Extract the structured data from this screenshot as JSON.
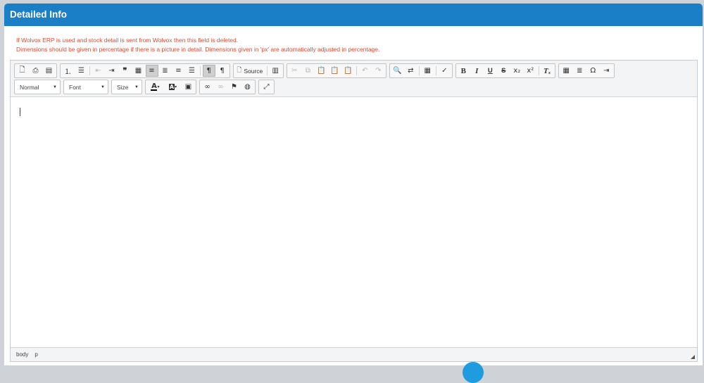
{
  "panel": {
    "title": "Detailed Info",
    "notes": [
      "If Wolvox ERP is used and stock detail is sent from Wolvox then this field is deleted.",
      "Dimensions should be given in percentage if there is a picture in detail. Dimensions given in 'px' are automatically adjusted in percentage."
    ]
  },
  "toolbar": {
    "source_label": "Source",
    "format_combo": "Normal",
    "font_combo": "Font",
    "size_combo": "Size"
  },
  "statusbar": {
    "path": [
      "body",
      "p"
    ]
  },
  "colors": {
    "header": "#1b7fc7",
    "note_text": "#e8462f",
    "fab": "#1f9be0"
  }
}
